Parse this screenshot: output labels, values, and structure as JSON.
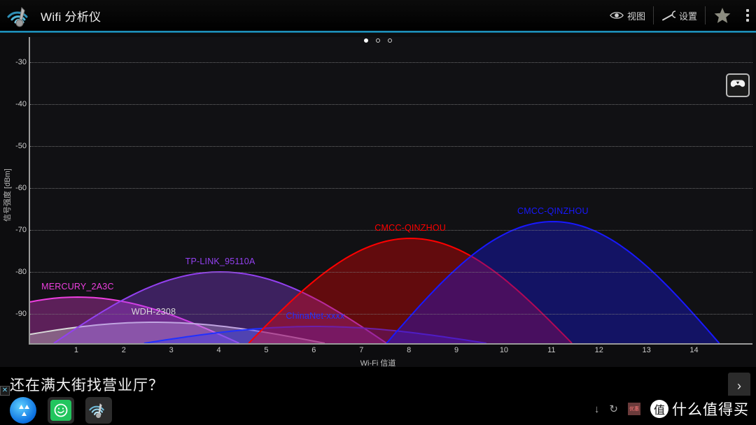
{
  "titlebar": {
    "app_title": "Wifi 分析仪",
    "logo_icon": "wifi-analyzer-logo",
    "actions": [
      {
        "label": "视图",
        "icon": "eye-icon",
        "name": "view"
      },
      {
        "label": "设置",
        "icon": "wrench-icon",
        "name": "settings"
      }
    ],
    "star_icon": "star-icon",
    "overflow_icon": "overflow-menu-icon",
    "accent_color": "#23a9d8"
  },
  "chart_data": {
    "type": "area",
    "title": "",
    "xlabel": "Wi-Fi 信道",
    "ylabel": "信号强度 [dBm]",
    "xticks": [
      1,
      2,
      3,
      4,
      5,
      6,
      7,
      8,
      9,
      10,
      11,
      12,
      13,
      14
    ],
    "yticks": [
      -30,
      -40,
      -50,
      -60,
      -70,
      -80,
      -90
    ],
    "xlim": [
      0.0,
      15.2
    ],
    "ylim": [
      -97,
      -24
    ],
    "grid": true,
    "legend": "inline-labels",
    "series": [
      {
        "name": "MERCURY_2A3C",
        "channel": 1,
        "level": -86,
        "width": 3.4,
        "color": "#ee3fe0"
      },
      {
        "name": "WDH-2308",
        "channel": 2.6,
        "level": -92,
        "width": 3.6,
        "color": "#d8d8d8"
      },
      {
        "name": "TP-LINK_95110A",
        "channel": 4,
        "level": -80,
        "width": 3.5,
        "color": "#9340f0"
      },
      {
        "name": "ChinaNet-xxxx",
        "channel": 6,
        "level": -93,
        "width": 3.6,
        "color": "#2030ff"
      },
      {
        "name": "CMCC-QINZHOU",
        "channel": 8,
        "level": -72,
        "width": 3.4,
        "color": "#ff0000"
      },
      {
        "name": "CMCC-QINZHOU",
        "channel": 11,
        "level": -68,
        "width": 3.5,
        "color": "#1818ff"
      }
    ]
  },
  "chart_overlay": {
    "fab_icon": "gamepad-icon"
  },
  "ad": {
    "headline": "还在满大街找营业厅？",
    "next_label": "›",
    "close_label": "✕",
    "dots": [
      true,
      false,
      false
    ]
  },
  "dock": {
    "items": [
      {
        "name": "app-store-icon",
        "label": ""
      },
      {
        "name": "green-clock-icon",
        "label": ""
      },
      {
        "name": "wifi-analyzer-icon",
        "label": ""
      }
    ],
    "right_icons": [
      {
        "name": "download-icon",
        "glyph": "↓"
      },
      {
        "name": "refresh-icon",
        "glyph": "↻"
      },
      {
        "name": "promo-badge-icon",
        "glyph": "优惠"
      }
    ],
    "watermark": {
      "badge": "值",
      "text": "什么值得买"
    }
  }
}
